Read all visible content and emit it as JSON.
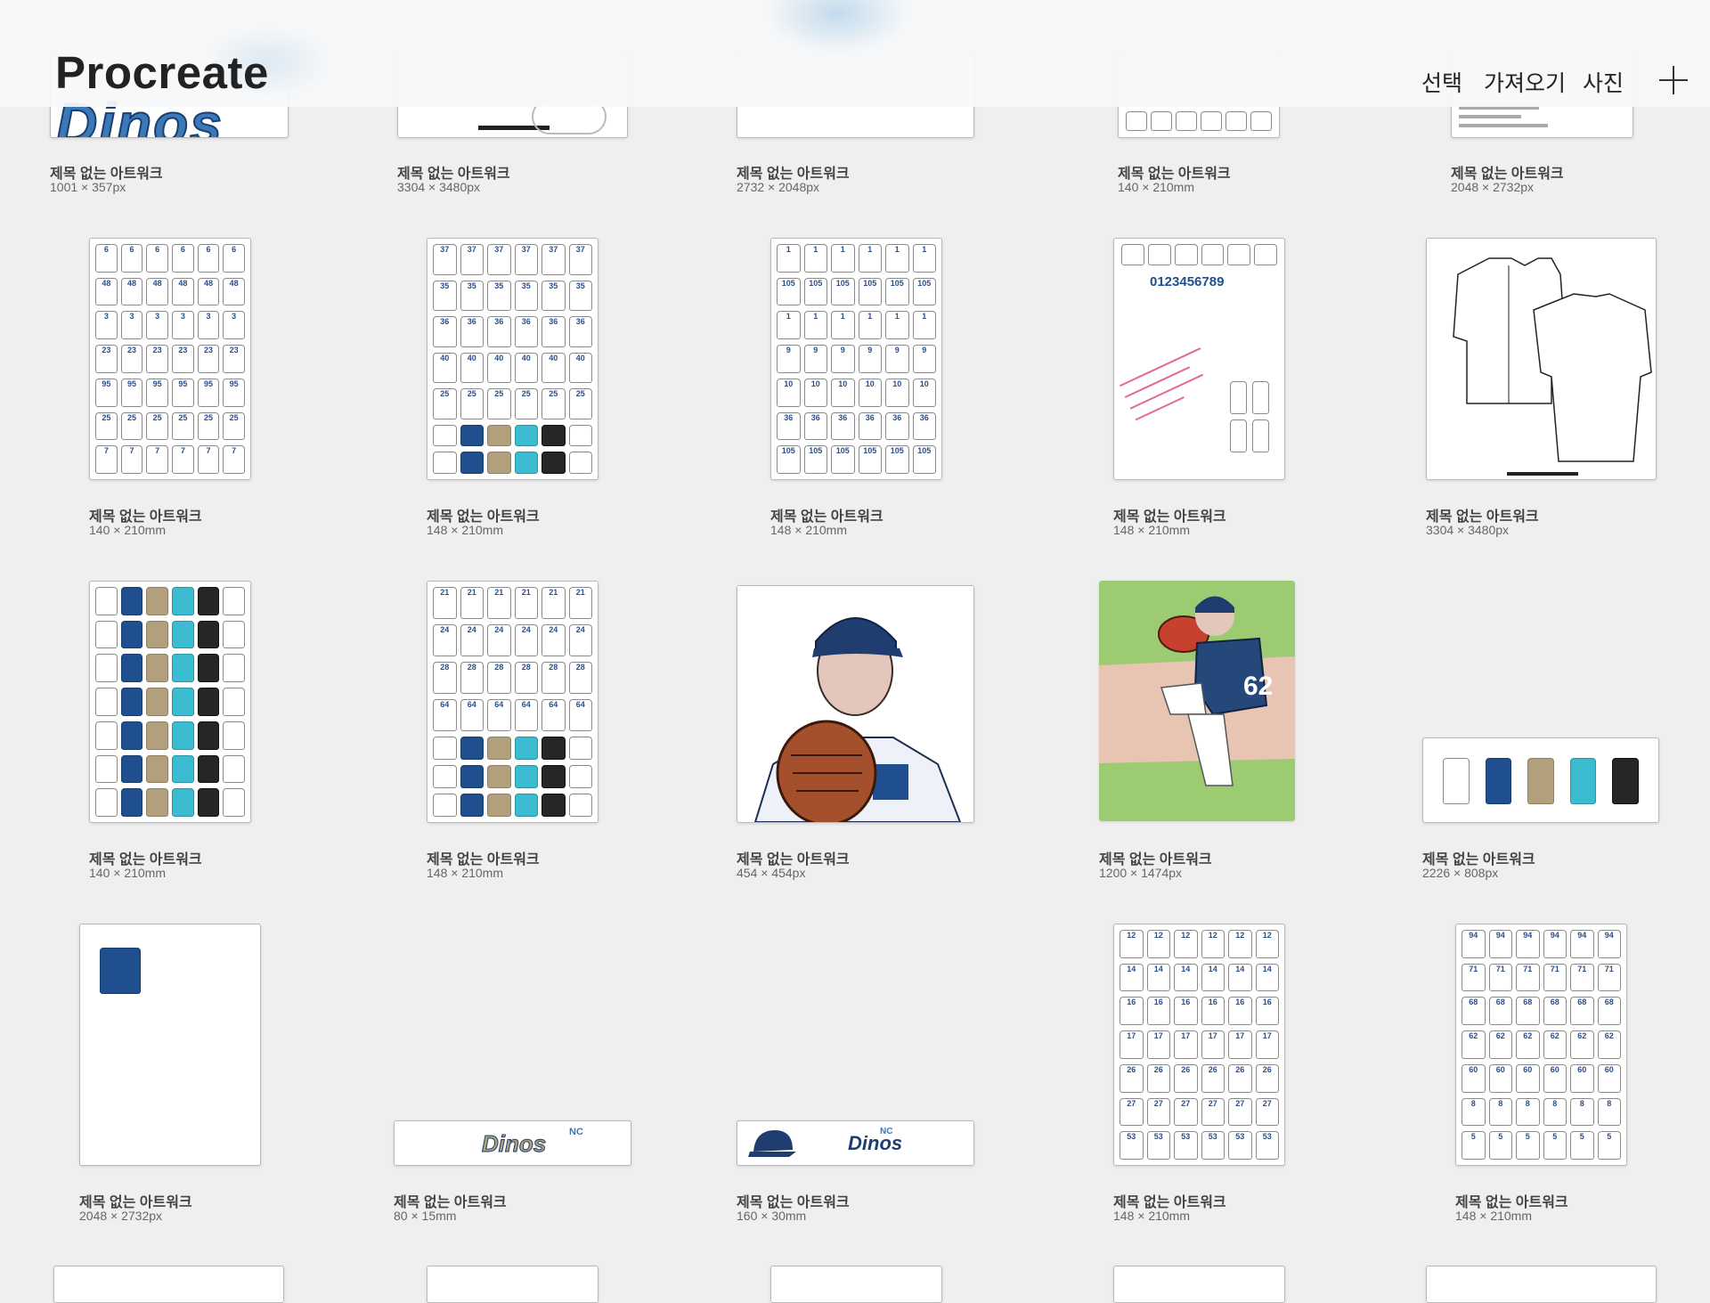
{
  "header": {
    "app_title": "Procreate",
    "select_label": "선택",
    "import_label": "가져오기",
    "photo_label": "사진",
    "add_icon": "plus-icon"
  },
  "gallery": {
    "row1": [
      {
        "title": "제목 없는 아트워크",
        "size": "1001 × 357px"
      },
      {
        "title": "제목 없는 아트워크",
        "size": "3304 × 3480px"
      },
      {
        "title": "제목 없는 아트워크",
        "size": "2732 × 2048px"
      },
      {
        "title": "제목 없는 아트워크",
        "size": "140 × 210mm"
      },
      {
        "title": "제목 없는 아트워크",
        "size": "2048 × 2732px"
      }
    ],
    "row2": [
      {
        "title": "제목 없는 아트워크",
        "size": "140 × 210mm"
      },
      {
        "title": "제목 없는 아트워크",
        "size": "148 × 210mm"
      },
      {
        "title": "제목 없는 아트워크",
        "size": "148 × 210mm"
      },
      {
        "title": "제목 없는 아트워크",
        "size": "148 × 210mm"
      },
      {
        "title": "제목 없는 아트워크",
        "size": "3304 × 3480px"
      }
    ],
    "row3": [
      {
        "title": "제목 없는 아트워크",
        "size": "140 × 210mm"
      },
      {
        "title": "제목 없는 아트워크",
        "size": "148 × 210mm"
      },
      {
        "title": "제목 없는 아트워크",
        "size": "454 × 454px"
      },
      {
        "title": "제목 없는 아트워크",
        "size": "1200 × 1474px"
      },
      {
        "title": "제목 없는 아트워크",
        "size": "2226 × 808px"
      }
    ],
    "row4": [
      {
        "title": "제목 없는 아트워크",
        "size": "2048 × 2732px"
      },
      {
        "title": "제목 없는 아트워크",
        "size": "80 × 15mm"
      },
      {
        "title": "제목 없는 아트워크",
        "size": "160 × 30mm"
      },
      {
        "title": "제목 없는 아트워크",
        "size": "148 × 210mm"
      },
      {
        "title": "제목 없는 아트워크",
        "size": "148 × 210mm"
      }
    ]
  },
  "thumb_text": {
    "dinos_logo": "Dinos",
    "nc_mark": "NC",
    "digits": "0123456789",
    "pitcher_number": "62",
    "sheet_numbers_a": [
      "6",
      "48",
      "3",
      "23",
      "95",
      "25",
      "7"
    ],
    "sheet_numbers_b": [
      "37",
      "35",
      "36",
      "40",
      "25"
    ],
    "sheet_numbers_c": [
      "1",
      "105",
      "1",
      "9",
      "10",
      "36",
      "105"
    ],
    "sheet_numbers_d": [
      "21",
      "24",
      "28",
      "64"
    ],
    "sheet_numbers_e": [
      "12",
      "14",
      "16",
      "17",
      "26",
      "27",
      "53"
    ],
    "sheet_numbers_f": [
      "94",
      "71",
      "68",
      "62",
      "60",
      "8",
      "5"
    ]
  },
  "colors": {
    "background": "#efefef",
    "navy": "#1f4f8f",
    "tan": "#b29f7b",
    "teal": "#3cbcd0",
    "black": "#262626",
    "field_green": "#9ccb72",
    "field_dirt": "#e8c5b3"
  }
}
